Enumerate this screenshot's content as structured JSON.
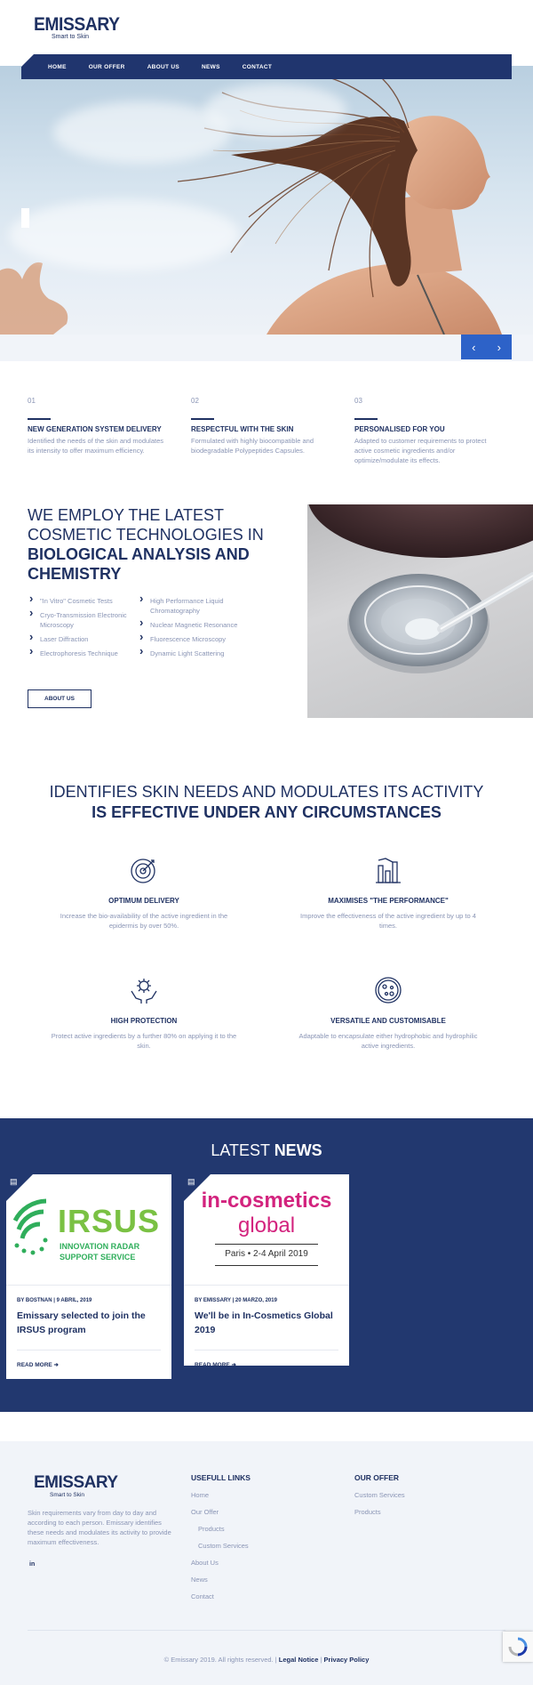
{
  "brand": {
    "name": "EMISSARY",
    "tagline": "Smart to Skin"
  },
  "nav": {
    "items": [
      "HOME",
      "OUR OFFER",
      "ABOUT US",
      "NEWS",
      "CONTACT"
    ]
  },
  "slider": {
    "prev": "‹",
    "next": "›"
  },
  "features3": [
    {
      "num": "01",
      "title": "NEW GENERATION SYSTEM DELIVERY",
      "text": "Identified the needs of the skin and modulates its intensity to offer maximum efficiency."
    },
    {
      "num": "02",
      "title": "RESPECTFUL WITH THE SKIN",
      "text": "Formulated with highly biocompatible and biodegradable Polypeptides Capsules."
    },
    {
      "num": "03",
      "title": "PERSONALISED FOR YOU",
      "text": "Adapted to customer requirements to protect active cosmetic ingredients and/or optimize/modulate its effects."
    }
  ],
  "tech": {
    "heading_light": "WE EMPLOY THE LATEST COSMETIC TECHNOLOGIES IN",
    "heading_bold": "BIOLOGICAL ANALYSIS AND CHEMISTRY",
    "list_left": [
      "\"In Vitro\" Cosmetic Tests",
      "Cryo-Transmission Electronic Microscopy",
      "Laser Diffraction",
      "Electrophoresis Technique"
    ],
    "list_right": [
      "High Performance Liquid Chromatography",
      "Nuclear Magnetic Resonance",
      "Fluorescence Microscopy",
      "Dynamic Light Scattering"
    ],
    "button": "ABOUT US"
  },
  "identifies": {
    "line1": "IDENTIFIES SKIN NEEDS AND MODULATES ITS ACTIVITY",
    "line2": "IS EFFECTIVE UNDER ANY CIRCUMSTANCES"
  },
  "features4": [
    {
      "icon": "target-icon",
      "title": "OPTIMUM DELIVERY",
      "text": "Increase the bio-availability of the active ingredient in the epidermis by over 50%."
    },
    {
      "icon": "bar-chart-icon",
      "title": "MAXIMISES \"THE PERFORMANCE\"",
      "text": "Improve the effectiveness of the active ingredient by up to 4 times."
    },
    {
      "icon": "protect-hands-icon",
      "title": "HIGH PROTECTION",
      "text": "Protect active ingredients by a further 80% on applying it to the skin."
    },
    {
      "icon": "petri-dish-icon",
      "title": "VERSATILE AND CUSTOMISABLE",
      "text": "Adaptable to encapsulate either hydrophobic and hydrophilic active ingredients."
    }
  ],
  "news": {
    "heading_light": "LATEST",
    "heading_bold": "NEWS",
    "cards": [
      {
        "image_title": "IRSUS",
        "image_sub1": "INNOVATION RADAR",
        "image_sub2": "SUPPORT SERVICE",
        "meta": "BY BOSTNAN | 9 ABRIL, 2019",
        "title": "Emissary selected to join the IRSUS program",
        "more": "READ MORE"
      },
      {
        "image_title": "in-cosmetics",
        "image_sub1": "global",
        "image_sub2": "Paris • 2-4 April 2019",
        "meta": "BY EMISSARY | 20 MARZO, 2019",
        "title": "We'll be in In-Cosmetics Global 2019",
        "more": "READ MORE"
      }
    ]
  },
  "footer": {
    "description": "Skin requirements vary from day to day and according to each person. Emissary identifies these needs and modulates its activity to provide maximum effectiveness.",
    "social": "in",
    "useful_heading": "USEFULL LINKS",
    "useful_links": [
      {
        "label": "Home",
        "sub": false
      },
      {
        "label": "Our Offer",
        "sub": false
      },
      {
        "label": "Products",
        "sub": true
      },
      {
        "label": "Custom Services",
        "sub": true
      },
      {
        "label": "About Us",
        "sub": false
      },
      {
        "label": "News",
        "sub": false
      },
      {
        "label": "Contact",
        "sub": false
      }
    ],
    "offer_heading": "OUR OFFER",
    "offer_links": [
      "Custom Services",
      "Products"
    ],
    "copyright": "© Emissary 2019. All rights reserved. |",
    "legal": "Legal Notice",
    "sep": "|",
    "privacy": "Privacy Policy"
  },
  "colors": {
    "navy": "#1f3162",
    "news_bg": "#22386f",
    "accent": "#2d62c8",
    "muted": "#8a95b5"
  }
}
